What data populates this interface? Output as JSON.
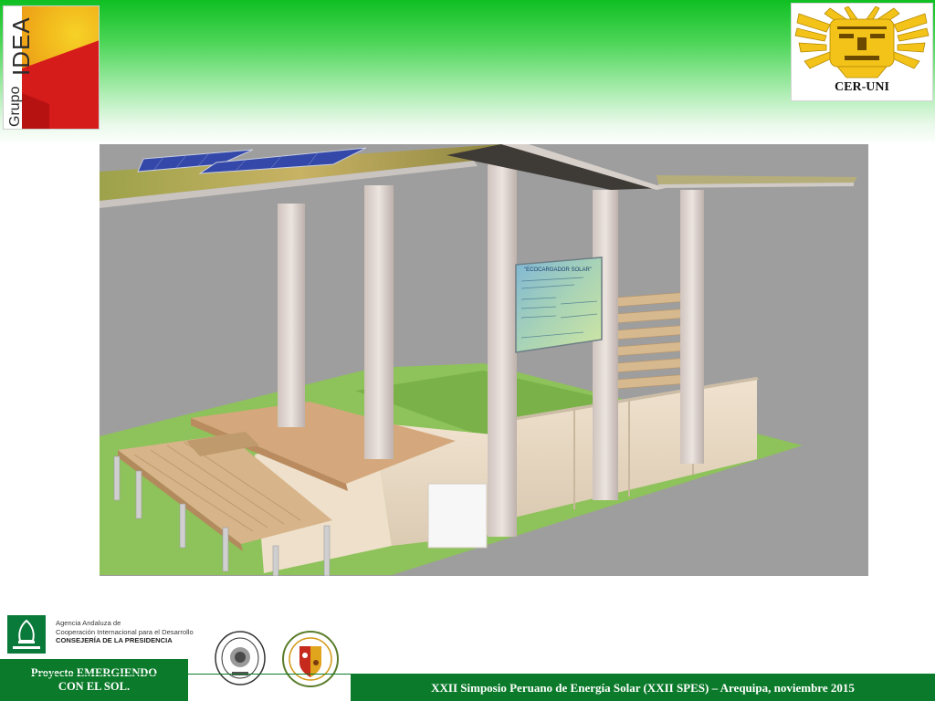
{
  "header": {
    "logo_left": {
      "line1": "Grupo",
      "line2": "IDEA"
    },
    "logo_right": {
      "label": "CER-UNI"
    }
  },
  "main_image": {
    "icon": "solar-kiosk-render"
  },
  "sign": {
    "title": "\"ECOCARGADOR SOLAR\""
  },
  "footer": {
    "agency": {
      "line1": "Agencia Andaluza de",
      "line2": "Cooperación Internacional para el Desarrollo",
      "line3": "CONSEJERÍA DE LA PRESIDENCIA"
    },
    "project_line1": "Proyecto EMERGIENDO",
    "project_line2": "CON EL SOL.",
    "symposium": "XXII Simposio Peruano de Energía Solar (XXII SPES) – Arequipa, noviembre 2015"
  },
  "colors": {
    "header_green": "#0fbf22",
    "footer_green": "#0b7a2a",
    "accent_yellow": "#f3c31a",
    "accent_red": "#d61b1b"
  }
}
